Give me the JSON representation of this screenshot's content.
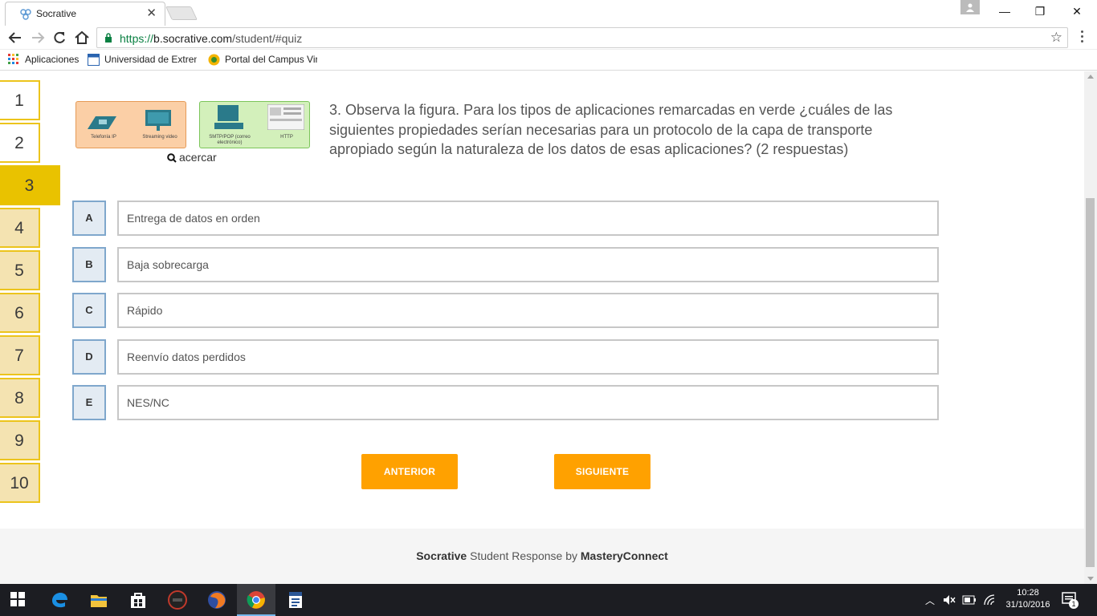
{
  "browser": {
    "tab_title": "Socrative",
    "tab_close": "✕",
    "url_secure": "https://",
    "url_host": "b.socrative.com",
    "url_path": "/student/#quiz",
    "star": "☆",
    "window_controls": {
      "minimize": "—",
      "restore": "❐",
      "close": "✕"
    }
  },
  "bookmarks": [
    {
      "label": "Aplicaciones"
    },
    {
      "label": "Universidad de Extrem"
    },
    {
      "label": "Portal del Campus Vir"
    }
  ],
  "question_nav": {
    "items": [
      "1",
      "2",
      "3",
      "4",
      "5",
      "6",
      "7",
      "8",
      "9",
      "10"
    ],
    "active_index": 2,
    "answered": [
      "1",
      "2"
    ]
  },
  "figure": {
    "orange_labels": [
      "Telefonía IP",
      "Streaming video"
    ],
    "green_labels": [
      "SMTP/POP (correo electrónico)",
      "HTTP"
    ],
    "zoom_label": "acercar"
  },
  "question": {
    "text": "3. Observa la figura. Para los tipos de aplicaciones remarcadas en verde ¿cuáles de las siguientes propiedades serían necesarias para un protocolo de la capa de transporte apropiado según la naturaleza de los datos de esas aplicaciones? (2 respuestas)"
  },
  "answers": [
    {
      "letter": "A",
      "text": "Entrega de datos en orden"
    },
    {
      "letter": "B",
      "text": "Baja sobrecarga"
    },
    {
      "letter": "C",
      "text": "Rápido"
    },
    {
      "letter": "D",
      "text": "Reenvío datos perdidos"
    },
    {
      "letter": "E",
      "text": "NES/NC"
    }
  ],
  "buttons": {
    "previous": "ANTERIOR",
    "next": "SIGUIENTE"
  },
  "footer": {
    "brand": "Socrative",
    "middle": " Student Response by ",
    "company": "MasteryConnect"
  },
  "taskbar": {
    "time": "10:28",
    "date": "31/10/2016",
    "notifications": "1"
  },
  "colors": {
    "accent_orange": "#ffa100",
    "nav_yellow": "#e9c200",
    "answer_letter_bg": "#e3ebf3"
  }
}
